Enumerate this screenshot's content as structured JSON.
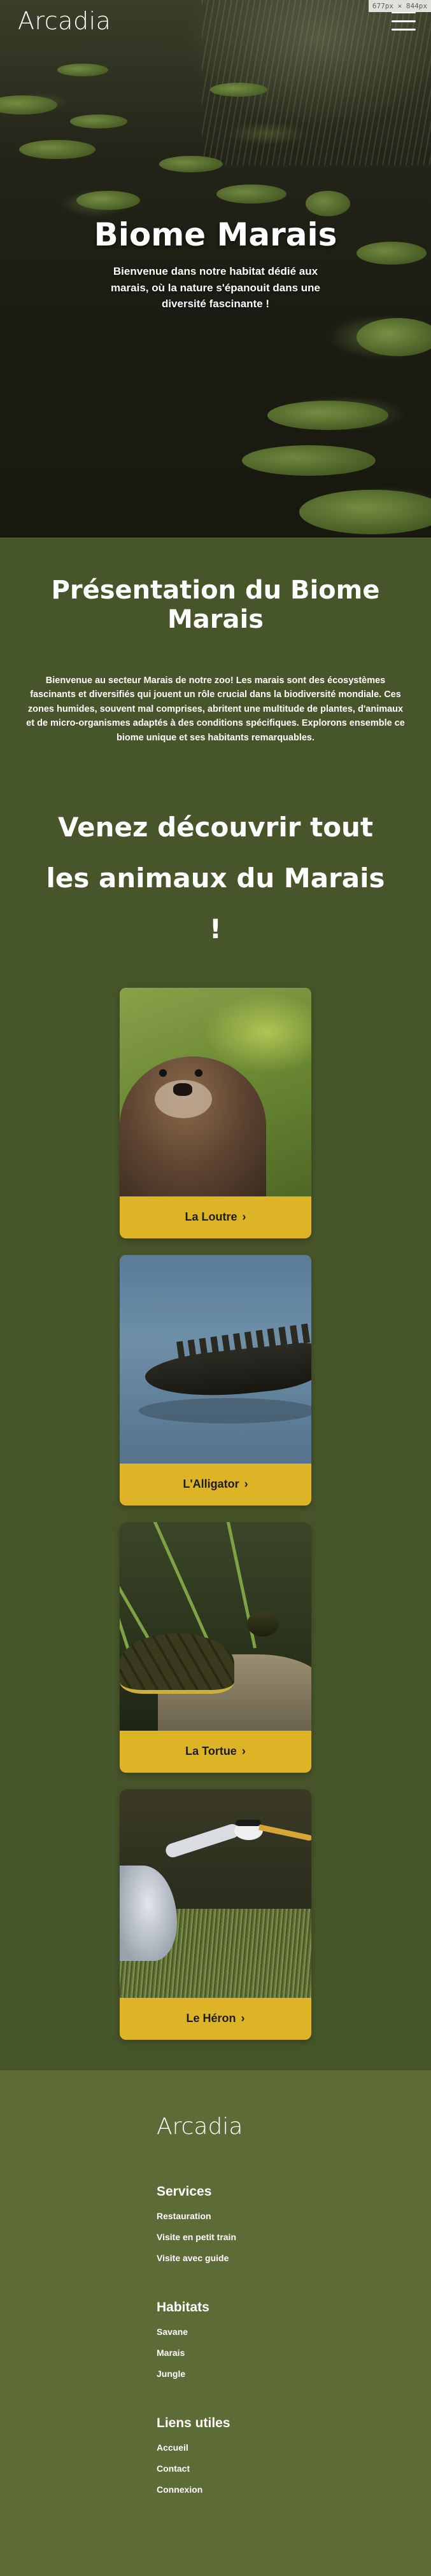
{
  "header": {
    "brand": "Arcadia",
    "viewport_tag": "677px × 844px",
    "menu_icon": "hamburger-icon"
  },
  "hero": {
    "title": "Biome Marais",
    "subtitle": "Bienvenue dans notre habitat dédié aux marais, où la nature s'épanouit dans une diversité fascinante !"
  },
  "presentation": {
    "title": "Présentation du Biome Marais",
    "text": "Bienvenue au secteur Marais de notre zoo! Les marais sont des écosystèmes fascinants et diversifiés qui jouent un rôle crucial dans la biodiversité mondiale. Ces zones humides, souvent mal comprises, abritent une multitude de plantes, d'animaux et de micro-organismes adaptés à des conditions spécifiques. Explorons ensemble ce biome unique et ses habitants remarquables."
  },
  "animals": {
    "title": "Venez découvrir tout les animaux du Marais !",
    "chevron_icon": "chevron-right-icon",
    "cards": [
      {
        "label": "La Loutre"
      },
      {
        "label": "L'Alligator"
      },
      {
        "label": "La Tortue"
      },
      {
        "label": "Le Héron"
      }
    ],
    "button_color": "#ddb426"
  },
  "footer": {
    "brand": "Arcadia",
    "groups": [
      {
        "title": "Services",
        "links": [
          "Restauration",
          "Visite en petit train",
          "Visite avec guide"
        ]
      },
      {
        "title": "Habitats",
        "links": [
          "Savane",
          "Marais",
          "Jungle"
        ]
      },
      {
        "title": "Liens utiles",
        "links": [
          "Accueil",
          "Contact",
          "Connexion"
        ]
      }
    ]
  },
  "colors": {
    "section_bg": "#47552a",
    "footer_bg": "#5d6b37",
    "accent": "#ddb426"
  }
}
